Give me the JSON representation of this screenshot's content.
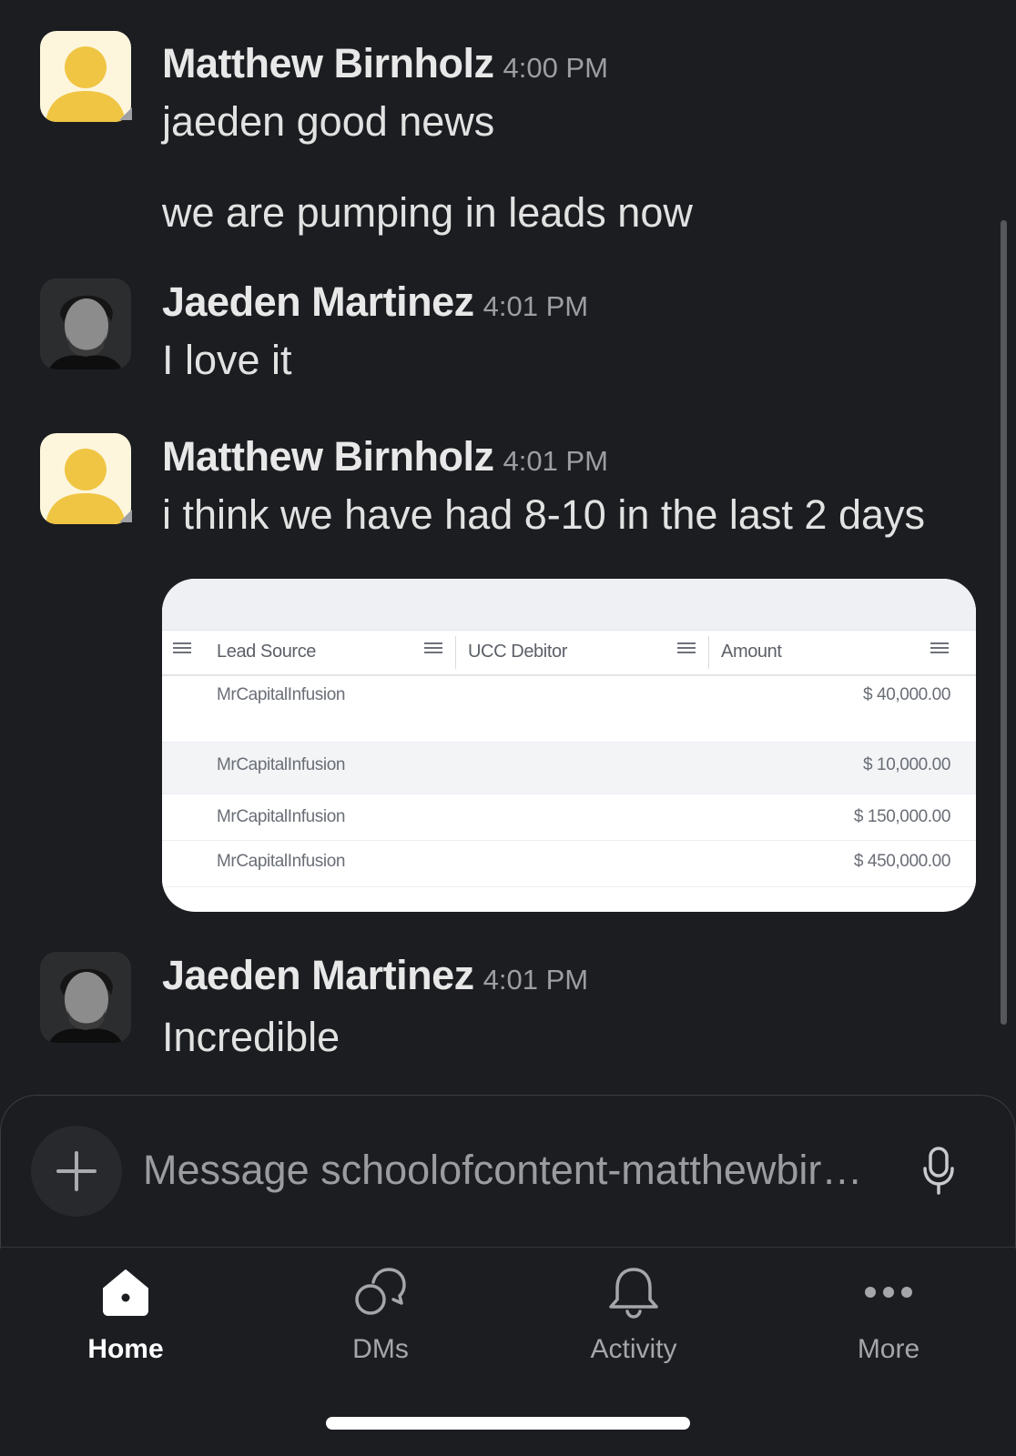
{
  "messages": [
    {
      "author": "Matthew Birnholz",
      "time": "4:00 PM",
      "avatar": "default-yellow-avatar",
      "lines": [
        "jaeden good news",
        "we are pumping in leads now"
      ]
    },
    {
      "author": "Jaeden Martinez",
      "time": "4:01 PM",
      "avatar": "profile-photo",
      "lines": [
        "I love it"
      ]
    },
    {
      "author": "Matthew Birnholz",
      "time": "4:01 PM",
      "avatar": "default-yellow-avatar",
      "lines": [
        "i think we have had 8-10 in the last 2 days"
      ]
    },
    {
      "author": "Jaeden Martinez",
      "time": "4:01 PM",
      "avatar": "profile-photo",
      "lines": [
        "Incredible"
      ]
    }
  ],
  "attachment": {
    "columns": [
      "Lead Source",
      "UCC Debitor",
      "Amount"
    ],
    "rows": [
      {
        "source": "MrCapitalInfusion",
        "amount": "$ 40,000.00"
      },
      {
        "source": "MrCapitalInfusion",
        "amount": "$ 10,000.00"
      },
      {
        "source": "MrCapitalInfusion",
        "amount": "$ 150,000.00"
      },
      {
        "source": "MrCapitalInfusion",
        "amount": "$ 450,000.00"
      }
    ]
  },
  "composer": {
    "placeholder": "Message schoolofcontent-matthewbir…"
  },
  "nav": [
    {
      "label": "Home",
      "icon": "home-icon",
      "active": true
    },
    {
      "label": "DMs",
      "icon": "dms-icon",
      "active": false
    },
    {
      "label": "Activity",
      "icon": "bell-icon",
      "active": false
    },
    {
      "label": "More",
      "icon": "more-dots-icon",
      "active": false
    }
  ],
  "colors": {
    "background": "#1b1d21",
    "avatar_yellow": "#f0c543",
    "avatar_bg": "#fdf6dd"
  }
}
